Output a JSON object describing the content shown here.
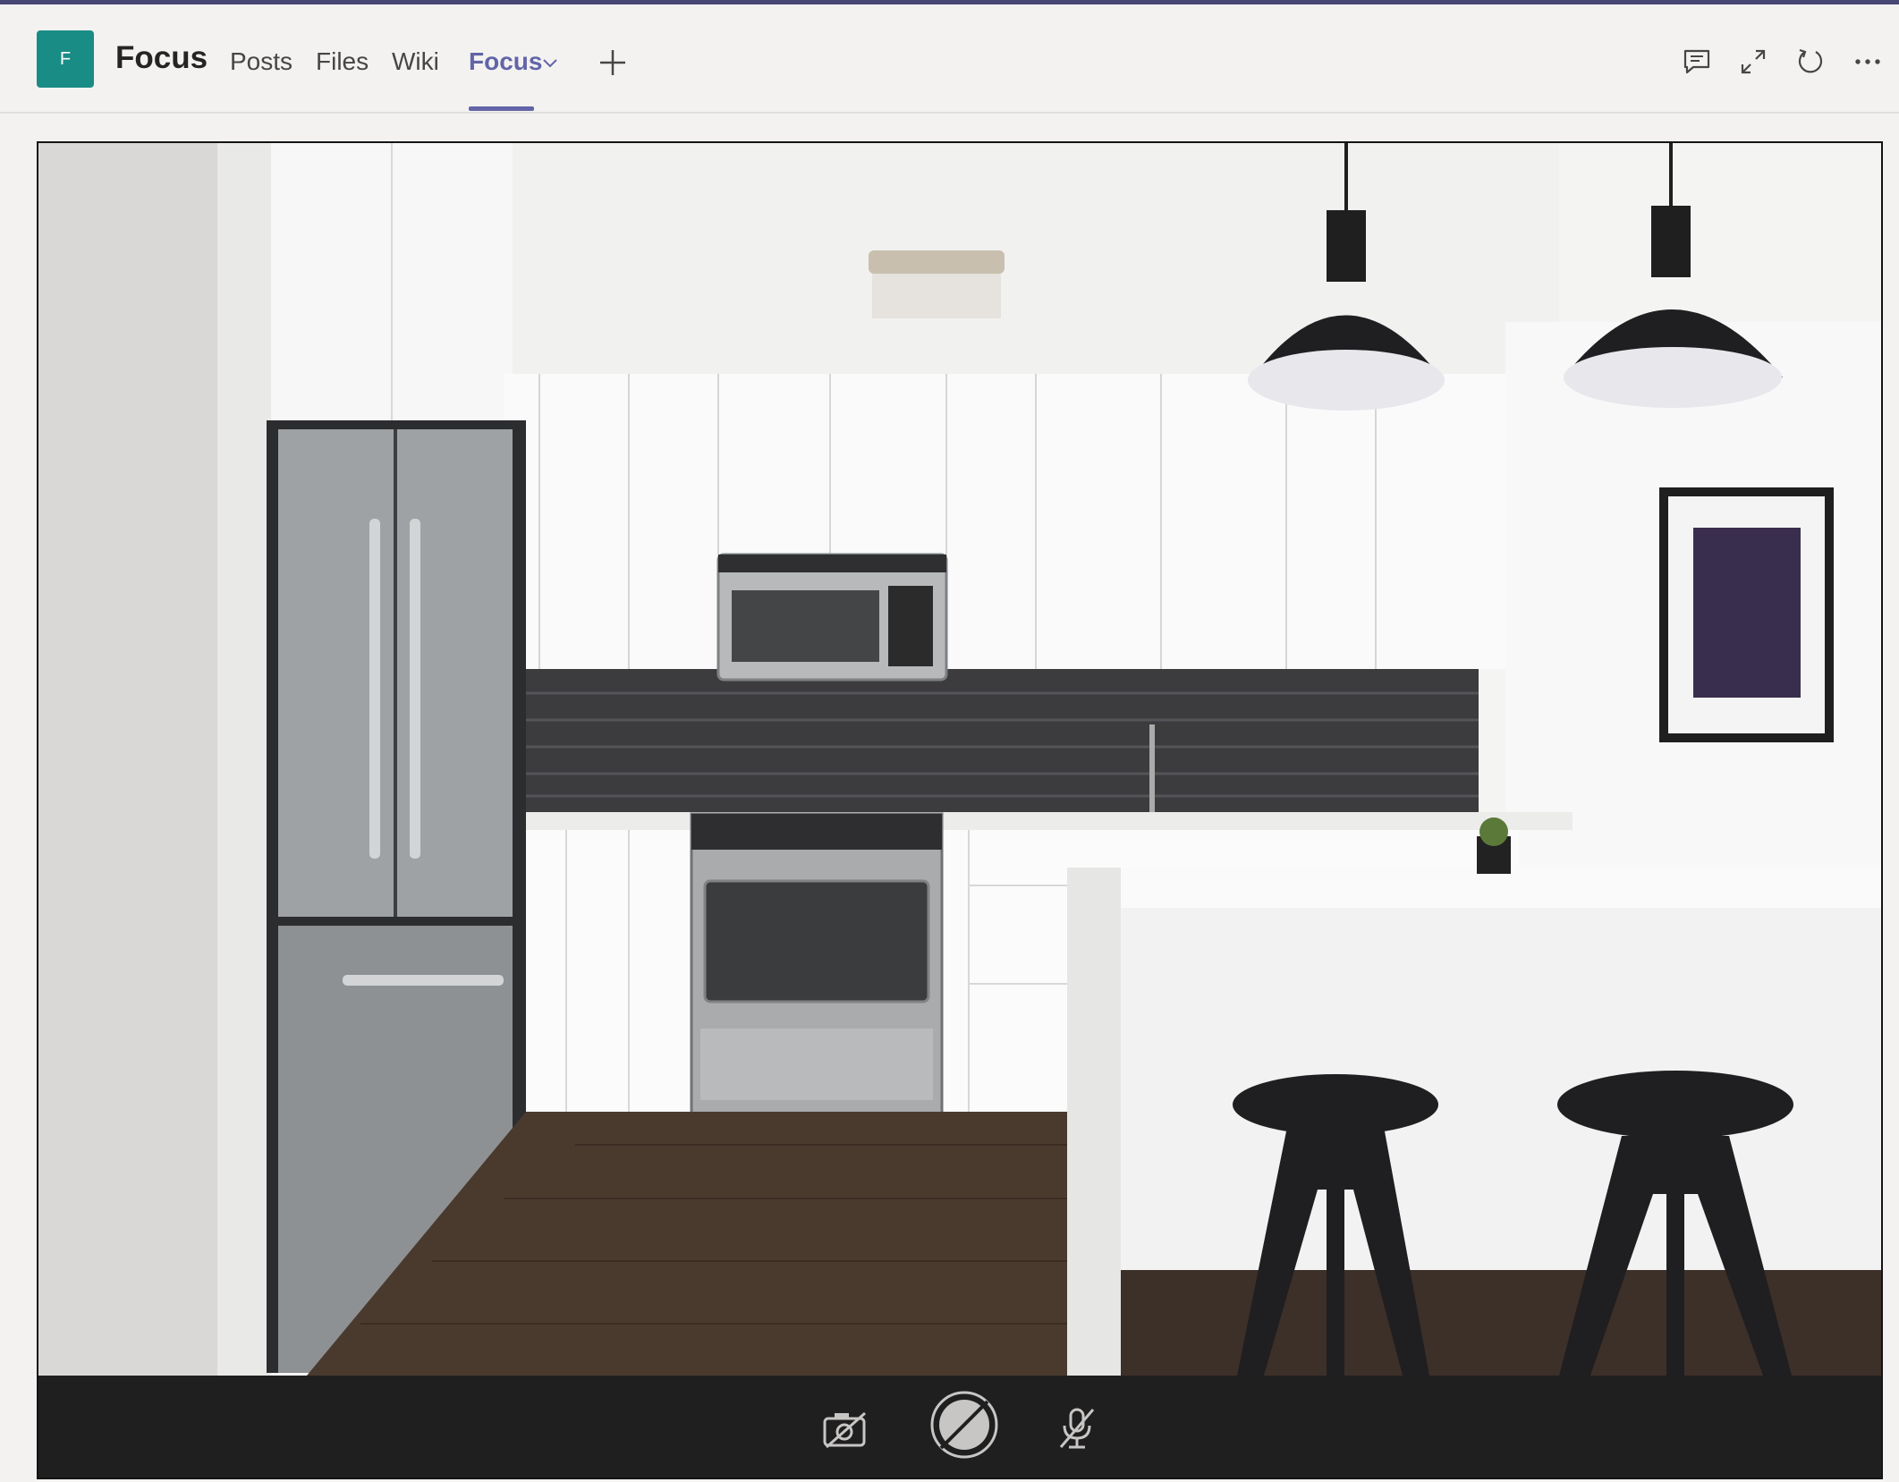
{
  "header": {
    "team_initial": "F",
    "team_name": "Focus",
    "tabs": [
      {
        "label": "Posts",
        "active": false
      },
      {
        "label": "Files",
        "active": false
      },
      {
        "label": "Wiki",
        "active": false
      },
      {
        "label": "Focus",
        "active": true
      }
    ],
    "actions": [
      "conversation-icon",
      "expand-icon",
      "reload-icon",
      "more-options-icon"
    ]
  },
  "content": {
    "image": "kitchen-photo",
    "controls": [
      "camera-off-icon",
      "record-disabled-icon",
      "mic-off-icon"
    ]
  },
  "colors": {
    "accent": "#6264a7",
    "team_avatar": "#1a8c86",
    "top_border": "#464775",
    "control_bar": "#1f1f1f"
  }
}
